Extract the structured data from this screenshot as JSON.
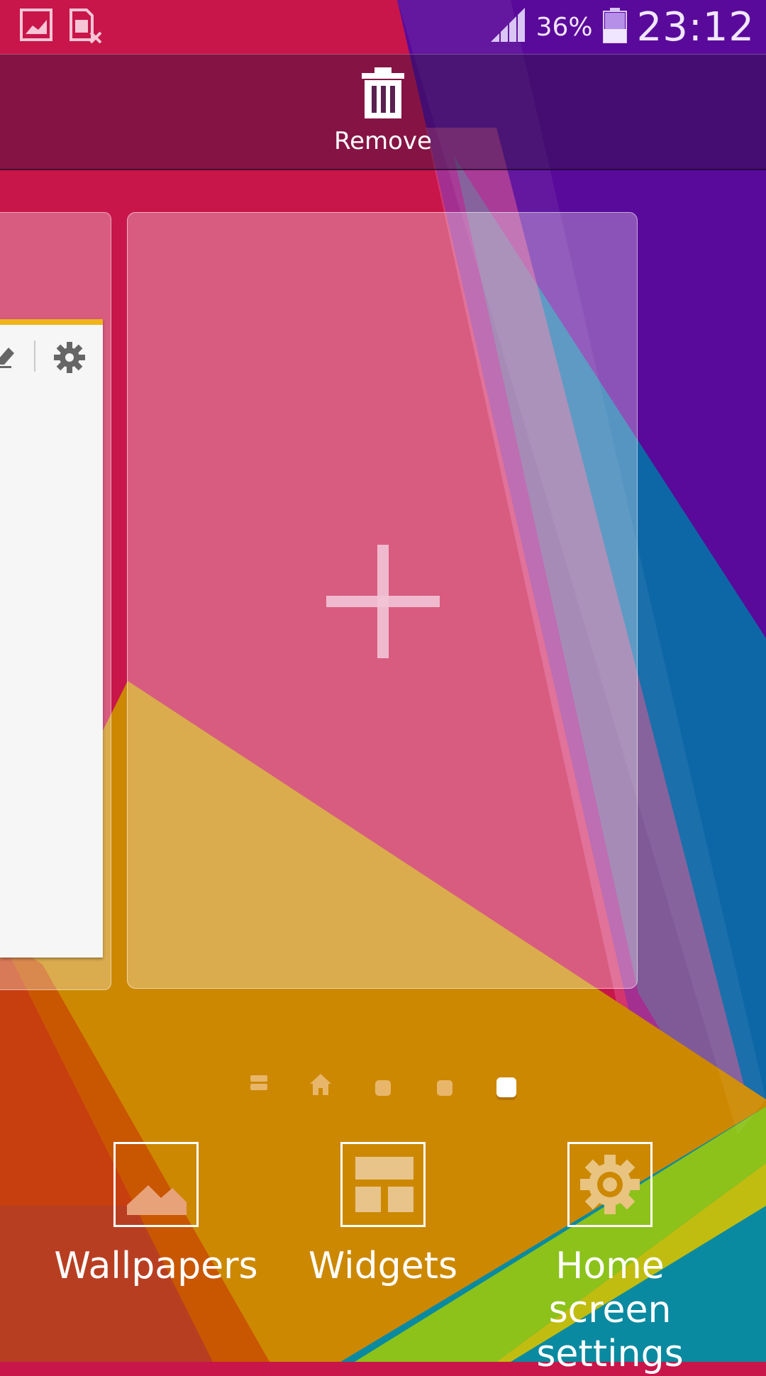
{
  "status_bar": {
    "icons": [
      "gallery-notification-icon",
      "sim-error-icon",
      "signal-icon",
      "battery-icon"
    ],
    "battery": "36%",
    "time": "23:12"
  },
  "remove_bar": {
    "label": "Remove",
    "icon": "trash-icon"
  },
  "pages": {
    "indicator_count": 5,
    "current_page": 5,
    "indicators": [
      "list-indicator",
      "home-indicator",
      "page-indicator",
      "page-indicator",
      "page-indicator-active"
    ]
  },
  "options": [
    {
      "label": "Wallpapers",
      "icon": "wallpaper-icon"
    },
    {
      "label": "Widgets",
      "icon": "widgets-icon"
    },
    {
      "label": "Home screen settings",
      "label_line1": "Home screen",
      "label_line2": "settings",
      "icon": "settings-icon"
    }
  ],
  "colors": {
    "accent_yellow": "#f0b419",
    "wallpaper_purple": "#5a0a9a",
    "wallpaper_pink": "#c8164a",
    "wallpaper_orange": "#cc8800",
    "wallpaper_teal": "#0a8aa0"
  }
}
